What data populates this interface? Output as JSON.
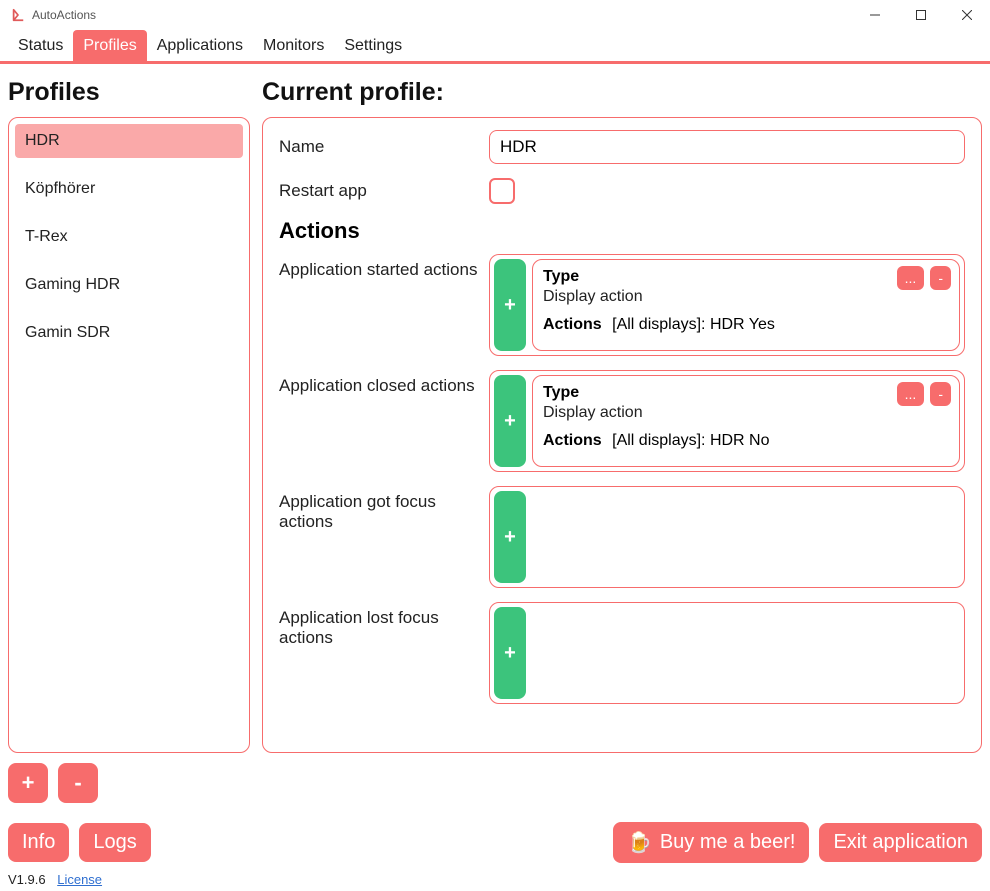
{
  "app": {
    "title": "AutoActions"
  },
  "menu": {
    "items": [
      "Status",
      "Profiles",
      "Applications",
      "Monitors",
      "Settings"
    ],
    "active_index": 1
  },
  "left": {
    "heading": "Profiles",
    "profiles": [
      "HDR",
      "Köpfhörer",
      "T-Rex",
      "Gaming HDR",
      "Gamin SDR"
    ],
    "selected_index": 0,
    "add_label": "+",
    "remove_label": "-"
  },
  "right": {
    "heading": "Current profile:",
    "name_label": "Name",
    "name_value": "HDR",
    "restart_label": "Restart app",
    "restart_checked": false,
    "actions_heading": "Actions",
    "groups": [
      {
        "label": "Application started actions",
        "card": {
          "type_label": "Type",
          "type_value": "Display action",
          "actions_label": "Actions",
          "actions_value": "[All displays]: HDR Yes",
          "edit_label": "...",
          "remove_label": "-"
        }
      },
      {
        "label": "Application closed actions",
        "card": {
          "type_label": "Type",
          "type_value": "Display action",
          "actions_label": "Actions",
          "actions_value": "[All displays]: HDR No",
          "edit_label": "...",
          "remove_label": "-"
        }
      },
      {
        "label": "Application got focus actions",
        "card": null
      },
      {
        "label": "Application lost focus actions",
        "card": null
      }
    ],
    "add_action_label": "+"
  },
  "footer": {
    "info_label": "Info",
    "logs_label": "Logs",
    "beer_label": "Buy me a beer!",
    "exit_label": "Exit application",
    "version": "V1.9.6",
    "license_label": "License"
  }
}
